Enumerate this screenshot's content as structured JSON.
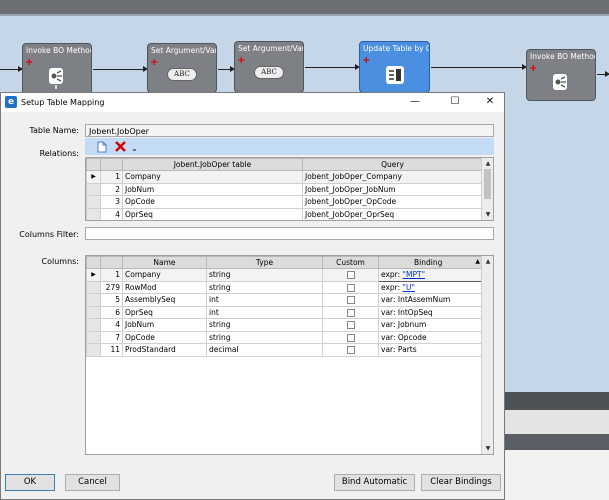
{
  "workflow": {
    "nodes": [
      {
        "title": "Invoke BO Method"
      },
      {
        "title": "Set Argument/Vari",
        "badge": "ABC"
      },
      {
        "title": "Set Argument/Vari",
        "badge": "ABC"
      },
      {
        "title": "Update Table by Q"
      },
      {
        "title": "Invoke BO Method"
      }
    ]
  },
  "dialog": {
    "title": "Setup Table Mapping",
    "window_buttons": {
      "minimize": "—",
      "maximize": "☐",
      "close": "✕"
    },
    "table_name_label": "Table Name:",
    "table_name_value": "Jobent.JobOper",
    "relations_label": "Relations:",
    "columns_filter_label": "Columns Filter:",
    "columns_filter_value": "",
    "columns_label": "Columns:",
    "relations_grid": {
      "headers": [
        "Jobent.JobOper table",
        "Query"
      ],
      "rows": [
        {
          "n": "1",
          "table": "Company",
          "query": "Jobent_JobOper_Company"
        },
        {
          "n": "2",
          "table": "JobNum",
          "query": "Jobent_JobOper_JobNum"
        },
        {
          "n": "3",
          "table": "OpCode",
          "query": "Jobent_JobOper_OpCode"
        },
        {
          "n": "4",
          "table": "OprSeq",
          "query": "Jobent_JobOper_OprSeq"
        }
      ]
    },
    "columns_grid": {
      "headers": [
        "Name",
        "Type",
        "Custom",
        "Binding"
      ],
      "rows": [
        {
          "n": "1",
          "name": "Company",
          "type": "string",
          "binding_prefix": "expr: ",
          "binding": "\"MPT\"",
          "link": true
        },
        {
          "n": "279",
          "name": "RowMod",
          "type": "string",
          "binding_prefix": "expr: ",
          "binding": "\"U\"",
          "link": true
        },
        {
          "n": "5",
          "name": "AssemblySeq",
          "type": "int",
          "binding_prefix": "var: ",
          "binding": "IntAssemNum",
          "link": false
        },
        {
          "n": "6",
          "name": "OprSeq",
          "type": "int",
          "binding_prefix": "var: ",
          "binding": "IntOpSeq",
          "link": false
        },
        {
          "n": "4",
          "name": "JobNum",
          "type": "string",
          "binding_prefix": "var: ",
          "binding": "Jobnum",
          "link": false
        },
        {
          "n": "7",
          "name": "OpCode",
          "type": "string",
          "binding_prefix": "var: ",
          "binding": "Opcode",
          "link": false
        },
        {
          "n": "11",
          "name": "ProdStandard",
          "type": "decimal",
          "binding_prefix": "var: ",
          "binding": "Parts",
          "link": false
        }
      ]
    },
    "buttons": {
      "ok": "OK",
      "cancel": "Cancel",
      "bind_automatic": "Bind Automatic",
      "clear_bindings": "Clear Bindings"
    }
  },
  "colors": {
    "canvas": "#c5d6e8",
    "selected_node": "#4a8fe0",
    "toolbar": "#c3dbf4",
    "link": "#0033cc",
    "delete_icon": "#d00000"
  }
}
